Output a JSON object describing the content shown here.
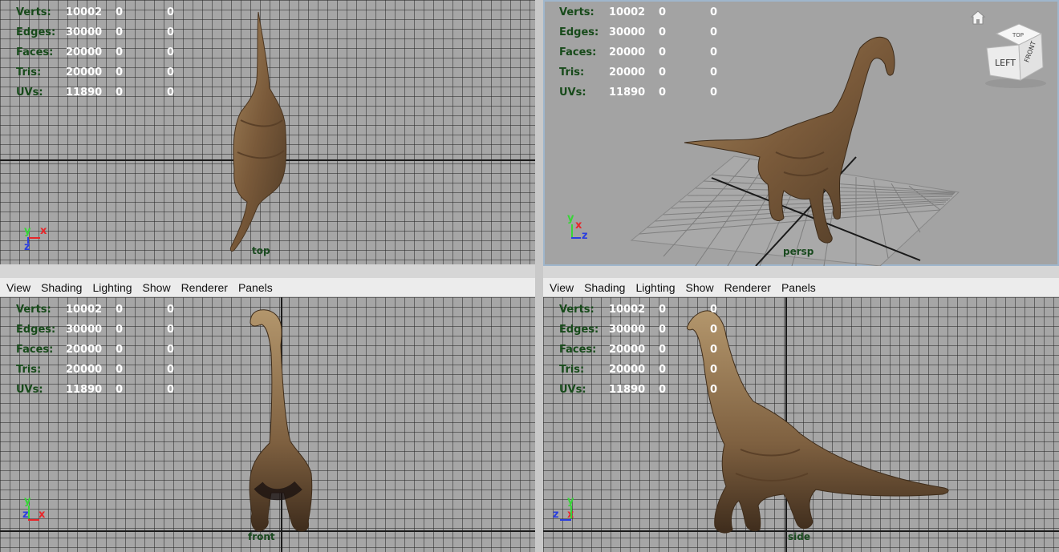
{
  "menu": {
    "view": "View",
    "shading": "Shading",
    "lighting": "Lighting",
    "show": "Show",
    "renderer": "Renderer",
    "panels": "Panels"
  },
  "hud": {
    "verts": {
      "label": "Verts:",
      "v1": "10002",
      "v2": "0",
      "v3": "0"
    },
    "edges": {
      "label": "Edges:",
      "v1": "30000",
      "v2": "0",
      "v3": "0"
    },
    "faces": {
      "label": "Faces:",
      "v1": "20000",
      "v2": "0",
      "v3": "0"
    },
    "tris": {
      "label": "Tris:",
      "v1": "20000",
      "v2": "0",
      "v3": "0"
    },
    "uvs": {
      "label": "UVs:",
      "v1": "11890",
      "v2": "0",
      "v3": "0"
    }
  },
  "viewports": {
    "top": {
      "name": "top"
    },
    "persp": {
      "name": "persp"
    },
    "front": {
      "name": "front"
    },
    "side": {
      "name": "side"
    }
  },
  "axes": {
    "x": "x",
    "y": "y",
    "z": "z"
  },
  "viewcube": {
    "left": "LEFT",
    "front": "FRONT",
    "top": "TOP"
  },
  "colors": {
    "hud_label": "#174a1a",
    "hud_value": "#ffffff",
    "axis_x": "#e8262a",
    "axis_y": "#37d637",
    "axis_z": "#2a3ee0",
    "grid_bg": "#a6a6a6",
    "model": "#8a6a44"
  }
}
